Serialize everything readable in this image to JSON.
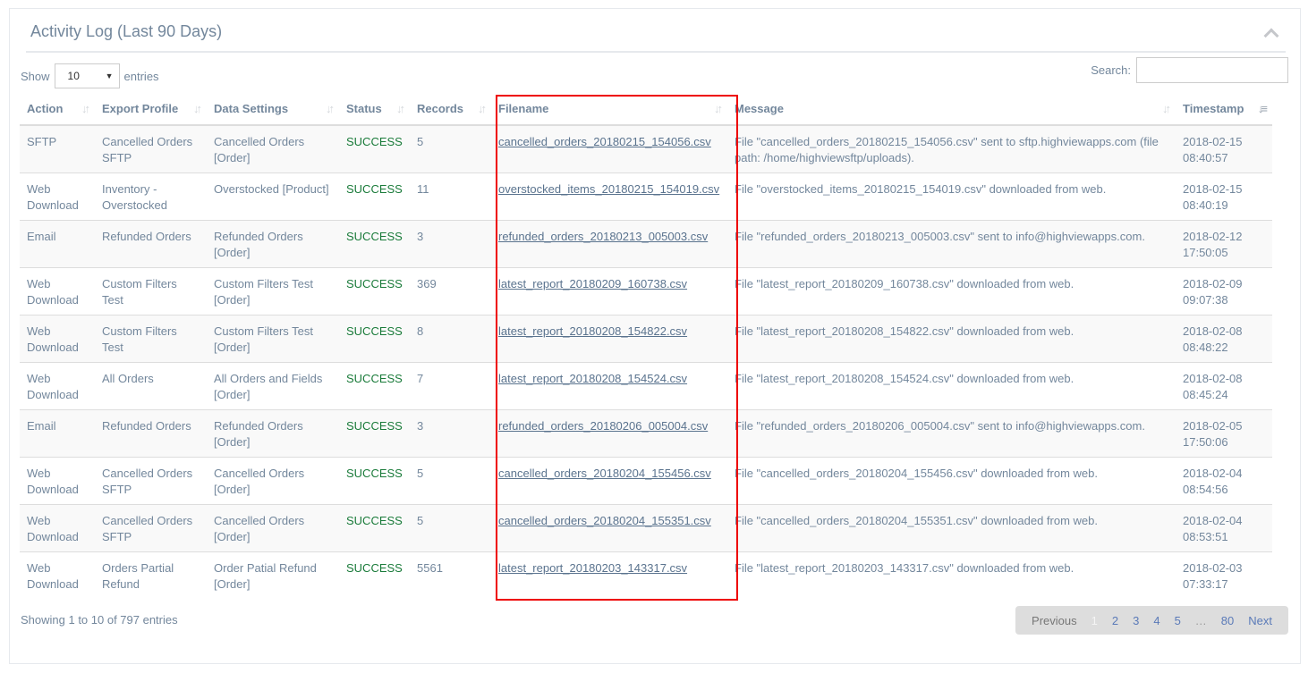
{
  "panel": {
    "title": "Activity Log (Last 90 Days)"
  },
  "controls": {
    "show_label": "Show",
    "entries_value": "10",
    "entries_label": "entries",
    "search_label": "Search:",
    "search_value": ""
  },
  "columns": [
    "Action",
    "Export Profile",
    "Data Settings",
    "Status",
    "Records",
    "Filename",
    "Message",
    "Timestamp"
  ],
  "rows": [
    [
      "SFTP",
      "Cancelled Orders SFTP",
      "Cancelled Orders [Order]",
      "SUCCESS",
      "5",
      "cancelled_orders_20180215_154056.csv",
      "File \"cancelled_orders_20180215_154056.csv\" sent to sftp.highviewapps.com (file path: /home/highviewsftp/uploads).",
      "2018-02-15 08:40:57"
    ],
    [
      "Web Download",
      "Inventory - Overstocked",
      "Overstocked [Product]",
      "SUCCESS",
      "11",
      "overstocked_items_20180215_154019.csv",
      "File \"overstocked_items_20180215_154019.csv\" downloaded from web.",
      "2018-02-15 08:40:19"
    ],
    [
      "Email",
      "Refunded Orders",
      "Refunded Orders [Order]",
      "SUCCESS",
      "3",
      "refunded_orders_20180213_005003.csv",
      "File \"refunded_orders_20180213_005003.csv\" sent to info@highviewapps.com.",
      "2018-02-12 17:50:05"
    ],
    [
      "Web Download",
      "Custom Filters Test",
      "Custom Filters Test [Order]",
      "SUCCESS",
      "369",
      "latest_report_20180209_160738.csv",
      "File \"latest_report_20180209_160738.csv\" downloaded from web.",
      "2018-02-09 09:07:38"
    ],
    [
      "Web Download",
      "Custom Filters Test",
      "Custom Filters Test [Order]",
      "SUCCESS",
      "8",
      "latest_report_20180208_154822.csv",
      "File \"latest_report_20180208_154822.csv\" downloaded from web.",
      "2018-02-08 08:48:22"
    ],
    [
      "Web Download",
      "All Orders",
      "All Orders and Fields [Order]",
      "SUCCESS",
      "7",
      "latest_report_20180208_154524.csv",
      "File \"latest_report_20180208_154524.csv\" downloaded from web.",
      "2018-02-08 08:45:24"
    ],
    [
      "Email",
      "Refunded Orders",
      "Refunded Orders [Order]",
      "SUCCESS",
      "3",
      "refunded_orders_20180206_005004.csv",
      "File \"refunded_orders_20180206_005004.csv\" sent to info@highviewapps.com.",
      "2018-02-05 17:50:06"
    ],
    [
      "Web Download",
      "Cancelled Orders SFTP",
      "Cancelled Orders [Order]",
      "SUCCESS",
      "5",
      "cancelled_orders_20180204_155456.csv",
      "File \"cancelled_orders_20180204_155456.csv\" downloaded from web.",
      "2018-02-04 08:54:56"
    ],
    [
      "Web Download",
      "Cancelled Orders SFTP",
      "Cancelled Orders [Order]",
      "SUCCESS",
      "5",
      "cancelled_orders_20180204_155351.csv",
      "File \"cancelled_orders_20180204_155351.csv\" downloaded from web.",
      "2018-02-04 08:53:51"
    ],
    [
      "Web Download",
      "Orders Partial Refund",
      "Order Patial Refund [Order]",
      "SUCCESS",
      "5561",
      "latest_report_20180203_143317.csv",
      "File \"latest_report_20180203_143317.csv\" downloaded from web.",
      "2018-02-03 07:33:17"
    ]
  ],
  "footer": {
    "info": "Showing 1 to 10 of 797 entries",
    "pages": [
      "Previous",
      "1",
      "2",
      "3",
      "4",
      "5",
      "…",
      "80",
      "Next"
    ],
    "current_page": "1"
  },
  "colors": {
    "success": "#1A7B3A",
    "highlight": "#EE0000"
  }
}
